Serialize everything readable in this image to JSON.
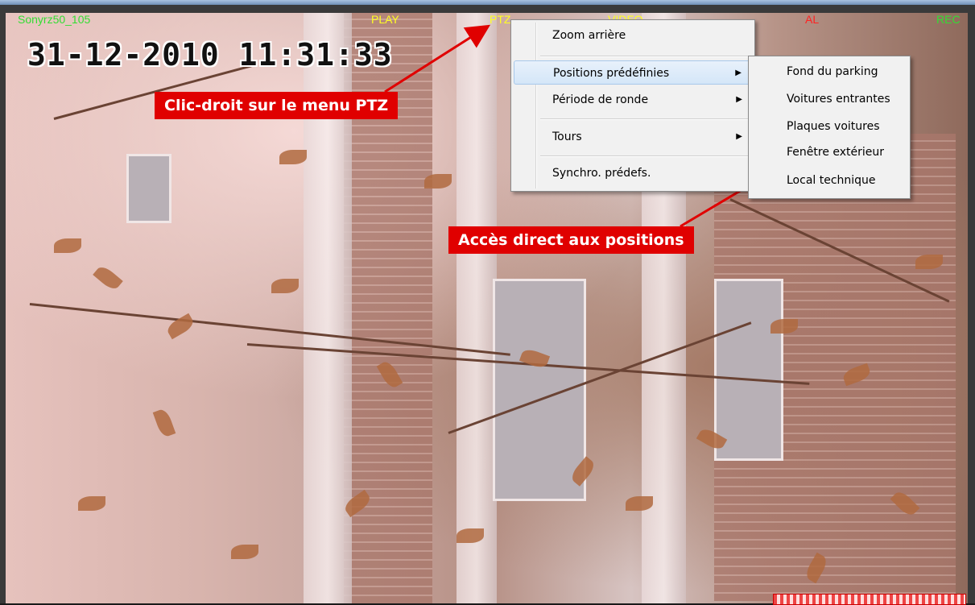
{
  "osd": {
    "camera_name": "Sonyrz50_105",
    "play": "PLAY",
    "ptz": "PTZ",
    "video": "VIDEO",
    "al": "AL",
    "rec": "REC",
    "datetime": "31-12-2010 11:31:33"
  },
  "callouts": {
    "right_click": "Clic-droit sur le menu PTZ",
    "direct_access": "Accès direct aux positions"
  },
  "context_menu": {
    "items": [
      {
        "label": "Zoom arrière"
      },
      {
        "label": "Positions prédéfinies",
        "submenu": true,
        "highlighted": true
      },
      {
        "label": "Période de ronde",
        "submenu": true
      },
      {
        "label": "Tours",
        "submenu": true
      },
      {
        "label": "Synchro. prédefs."
      }
    ],
    "chevron": "▶"
  },
  "submenu": {
    "items": [
      {
        "label": "Fond du parking"
      },
      {
        "label": "Voitures entrantes"
      },
      {
        "label": "Plaques voitures"
      },
      {
        "label": "Fenêtre extérieur"
      },
      {
        "label": "Local technique"
      }
    ]
  },
  "colors": {
    "osd_green": "#33dd33",
    "osd_yellow": "#ffff22",
    "osd_red": "#ff2222",
    "callout_red": "#e00000"
  }
}
